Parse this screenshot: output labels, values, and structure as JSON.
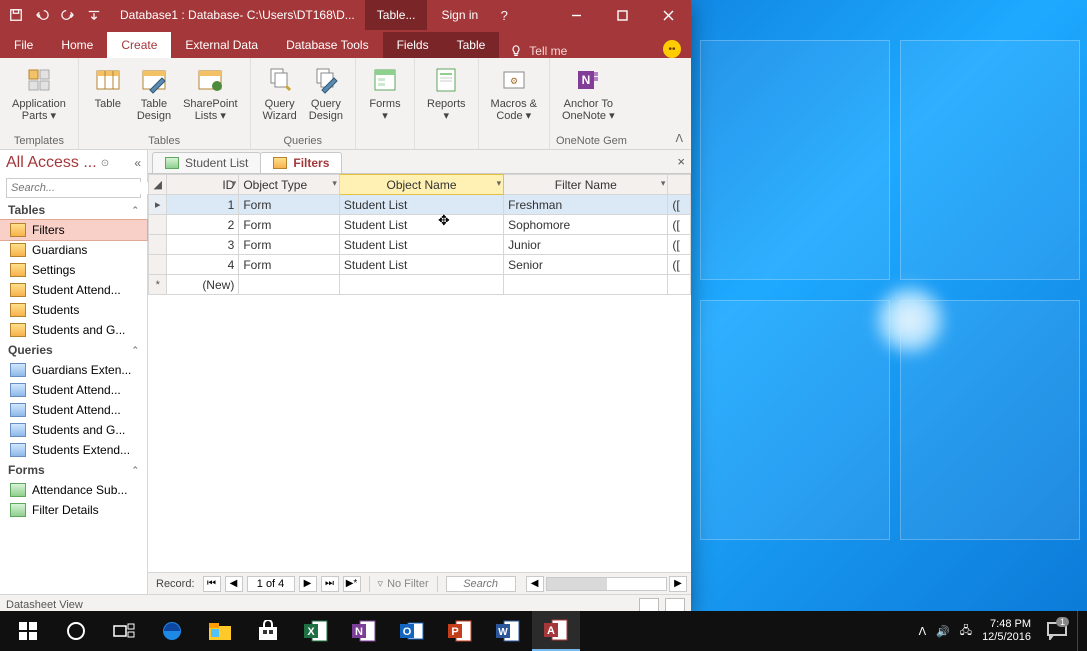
{
  "titlebar": {
    "title": "Database1 : Database- C:\\Users\\DT168\\D...",
    "context_tab": "Table...",
    "signin": "Sign in",
    "help": "?"
  },
  "ribbon_tabs": {
    "file": "File",
    "home": "Home",
    "create": "Create",
    "external": "External Data",
    "dbtools": "Database Tools",
    "fields": "Fields",
    "table": "Table",
    "tellme": "Tell me"
  },
  "ribbon": {
    "app_parts": "Application\nParts ▾",
    "templates": "Templates",
    "table": "Table",
    "table_design": "Table\nDesign",
    "sharepoint": "SharePoint\nLists ▾",
    "tables_group": "Tables",
    "qwizard": "Query\nWizard",
    "qdesign": "Query\nDesign",
    "queries_group": "Queries",
    "forms": "Forms\n▾",
    "reports": "Reports\n▾",
    "macros": "Macros &\nCode ▾",
    "anchor": "Anchor To\nOneNote ▾",
    "onenote_group": "OneNote Gem"
  },
  "nav": {
    "header": "All Access ...",
    "search_ph": "Search...",
    "tables": "Tables",
    "queries": "Queries",
    "forms": "Forms",
    "t_items": [
      "Filters",
      "Guardians",
      "Settings",
      "Student Attend...",
      "Students",
      "Students and G..."
    ],
    "q_items": [
      "Guardians Exten...",
      "Student Attend...",
      "Student Attend...",
      "Students and G...",
      "Students Extend..."
    ],
    "f_items": [
      "Attendance Sub...",
      "Filter Details"
    ]
  },
  "doc_tabs": {
    "tab1": "Student List",
    "tab2": "Filters",
    "close": "×"
  },
  "grid": {
    "headers": {
      "id": "ID",
      "otype": "Object Type",
      "oname": "Object Name",
      "fname": "Filter Name"
    },
    "rows": [
      {
        "id": "1",
        "otype": "Form",
        "oname": "Student List",
        "fname": "Freshman",
        "tail": "(["
      },
      {
        "id": "2",
        "otype": "Form",
        "oname": "Student List",
        "fname": "Sophomore",
        "tail": "(["
      },
      {
        "id": "3",
        "otype": "Form",
        "oname": "Student List",
        "fname": "Junior",
        "tail": "(["
      },
      {
        "id": "4",
        "otype": "Form",
        "oname": "Student List",
        "fname": "Senior",
        "tail": "(["
      }
    ],
    "new_row": "(New)"
  },
  "recnav": {
    "label": "Record:",
    "pos": "1 of 4",
    "nofilter": "No Filter",
    "search": "Search"
  },
  "status": {
    "view": "Datasheet View"
  },
  "taskbar": {
    "time": "7:48 PM",
    "date": "12/5/2016",
    "notif_count": "1"
  }
}
